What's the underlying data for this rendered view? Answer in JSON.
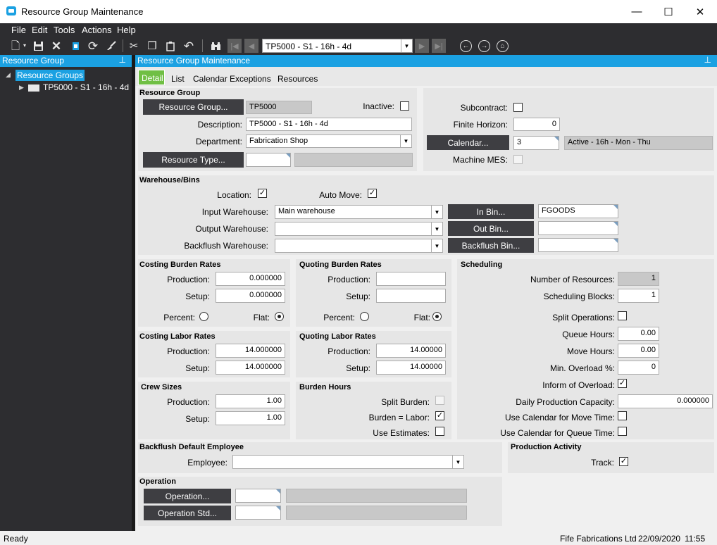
{
  "window": {
    "title": "Resource Group Maintenance",
    "minimize": "—",
    "maximize": "☐",
    "close": "✕"
  },
  "menu": [
    "File",
    "Edit",
    "Tools",
    "Actions",
    "Help"
  ],
  "toolbar": {
    "nav_value": "TP5000 - S1 - 16h - 4d"
  },
  "left_panel": {
    "title": "Resource Group",
    "tree_root": "Resource Groups",
    "tree_child": "TP5000 - S1 - 16h - 4d"
  },
  "main": {
    "title": "Resource Group Maintenance"
  },
  "tabs": [
    "Detail",
    "List",
    "Calendar Exceptions",
    "Resources"
  ],
  "resource_group": {
    "section": "Resource Group",
    "group_button": "Resource Group...",
    "group_value": "TP5000",
    "inactive_label": "Inactive:",
    "description_label": "Description:",
    "description_value": "TP5000 - S1 - 16h - 4d",
    "department_label": "Department:",
    "department_value": "Fabrication Shop",
    "type_button": "Resource Type..."
  },
  "right_top": {
    "subcontract_label": "Subcontract:",
    "finite_label": "Finite Horizon:",
    "finite_value": "0",
    "calendar_button": "Calendar...",
    "calendar_value": "3",
    "calendar_desc": "Active - 16h - Mon - Thu",
    "mes_label": "Machine MES:"
  },
  "warehouse": {
    "section": "Warehouse/Bins",
    "location_label": "Location:",
    "automove_label": "Auto Move:",
    "input_label": "Input Warehouse:",
    "input_value": "Main warehouse",
    "output_label": "Output Warehouse:",
    "backflush_label": "Backflush Warehouse:",
    "inbin_button": "In Bin...",
    "inbin_value": "FGOODS",
    "outbin_button": "Out Bin...",
    "backflushbin_button": "Backflush Bin..."
  },
  "costing_burden": {
    "title": "Costing Burden Rates",
    "production_label": "Production:",
    "production": "0.000000",
    "setup_label": "Setup:",
    "setup": "0.000000",
    "percent_label": "Percent:",
    "flat_label": "Flat:"
  },
  "quoting_burden": {
    "title": "Quoting Burden Rates",
    "production_label": "Production:",
    "setup_label": "Setup:",
    "percent_label": "Percent:",
    "flat_label": "Flat:"
  },
  "costing_labor": {
    "title": "Costing Labor Rates",
    "production_label": "Production:",
    "production": "14.000000",
    "setup_label": "Setup:",
    "setup": "14.000000"
  },
  "quoting_labor": {
    "title": "Quoting Labor Rates",
    "production_label": "Production:",
    "production": "14.00000",
    "setup_label": "Setup:",
    "setup": "14.00000"
  },
  "crew": {
    "title": "Crew Sizes",
    "production_label": "Production:",
    "production": "1.00",
    "setup_label": "Setup:",
    "setup": "1.00"
  },
  "burden_hours": {
    "title": "Burden Hours",
    "split_label": "Split Burden:",
    "labor_label": "Burden = Labor:",
    "estimates_label": "Use Estimates:"
  },
  "scheduling": {
    "title": "Scheduling",
    "num_resources_label": "Number of Resources:",
    "num_resources": "1",
    "blocks_label": "Scheduling Blocks:",
    "blocks": "1",
    "split_ops_label": "Split Operations:",
    "queue_label": "Queue Hours:",
    "queue": "0.00",
    "move_label": "Move Hours:",
    "move": "0.00",
    "overload_label": "Min. Overload %:",
    "overload": "0",
    "inform_label": "Inform of Overload:",
    "capacity_label": "Daily Production Capacity:",
    "capacity": "0.000000",
    "cal_move_label": "Use Calendar for Move Time:",
    "cal_queue_label": "Use Calendar for Queue Time:"
  },
  "backflush_employee": {
    "title": "Backflush Default Employee",
    "employee_label": "Employee:"
  },
  "production_activity": {
    "title": "Production Activity",
    "track_label": "Track:"
  },
  "operation": {
    "title": "Operation",
    "op_button": "Operation...",
    "opstd_button": "Operation Std..."
  },
  "status": {
    "left": "Ready",
    "company": "Fife Fabrications Ltd",
    "date": "22/09/2020",
    "time": "11:55"
  }
}
